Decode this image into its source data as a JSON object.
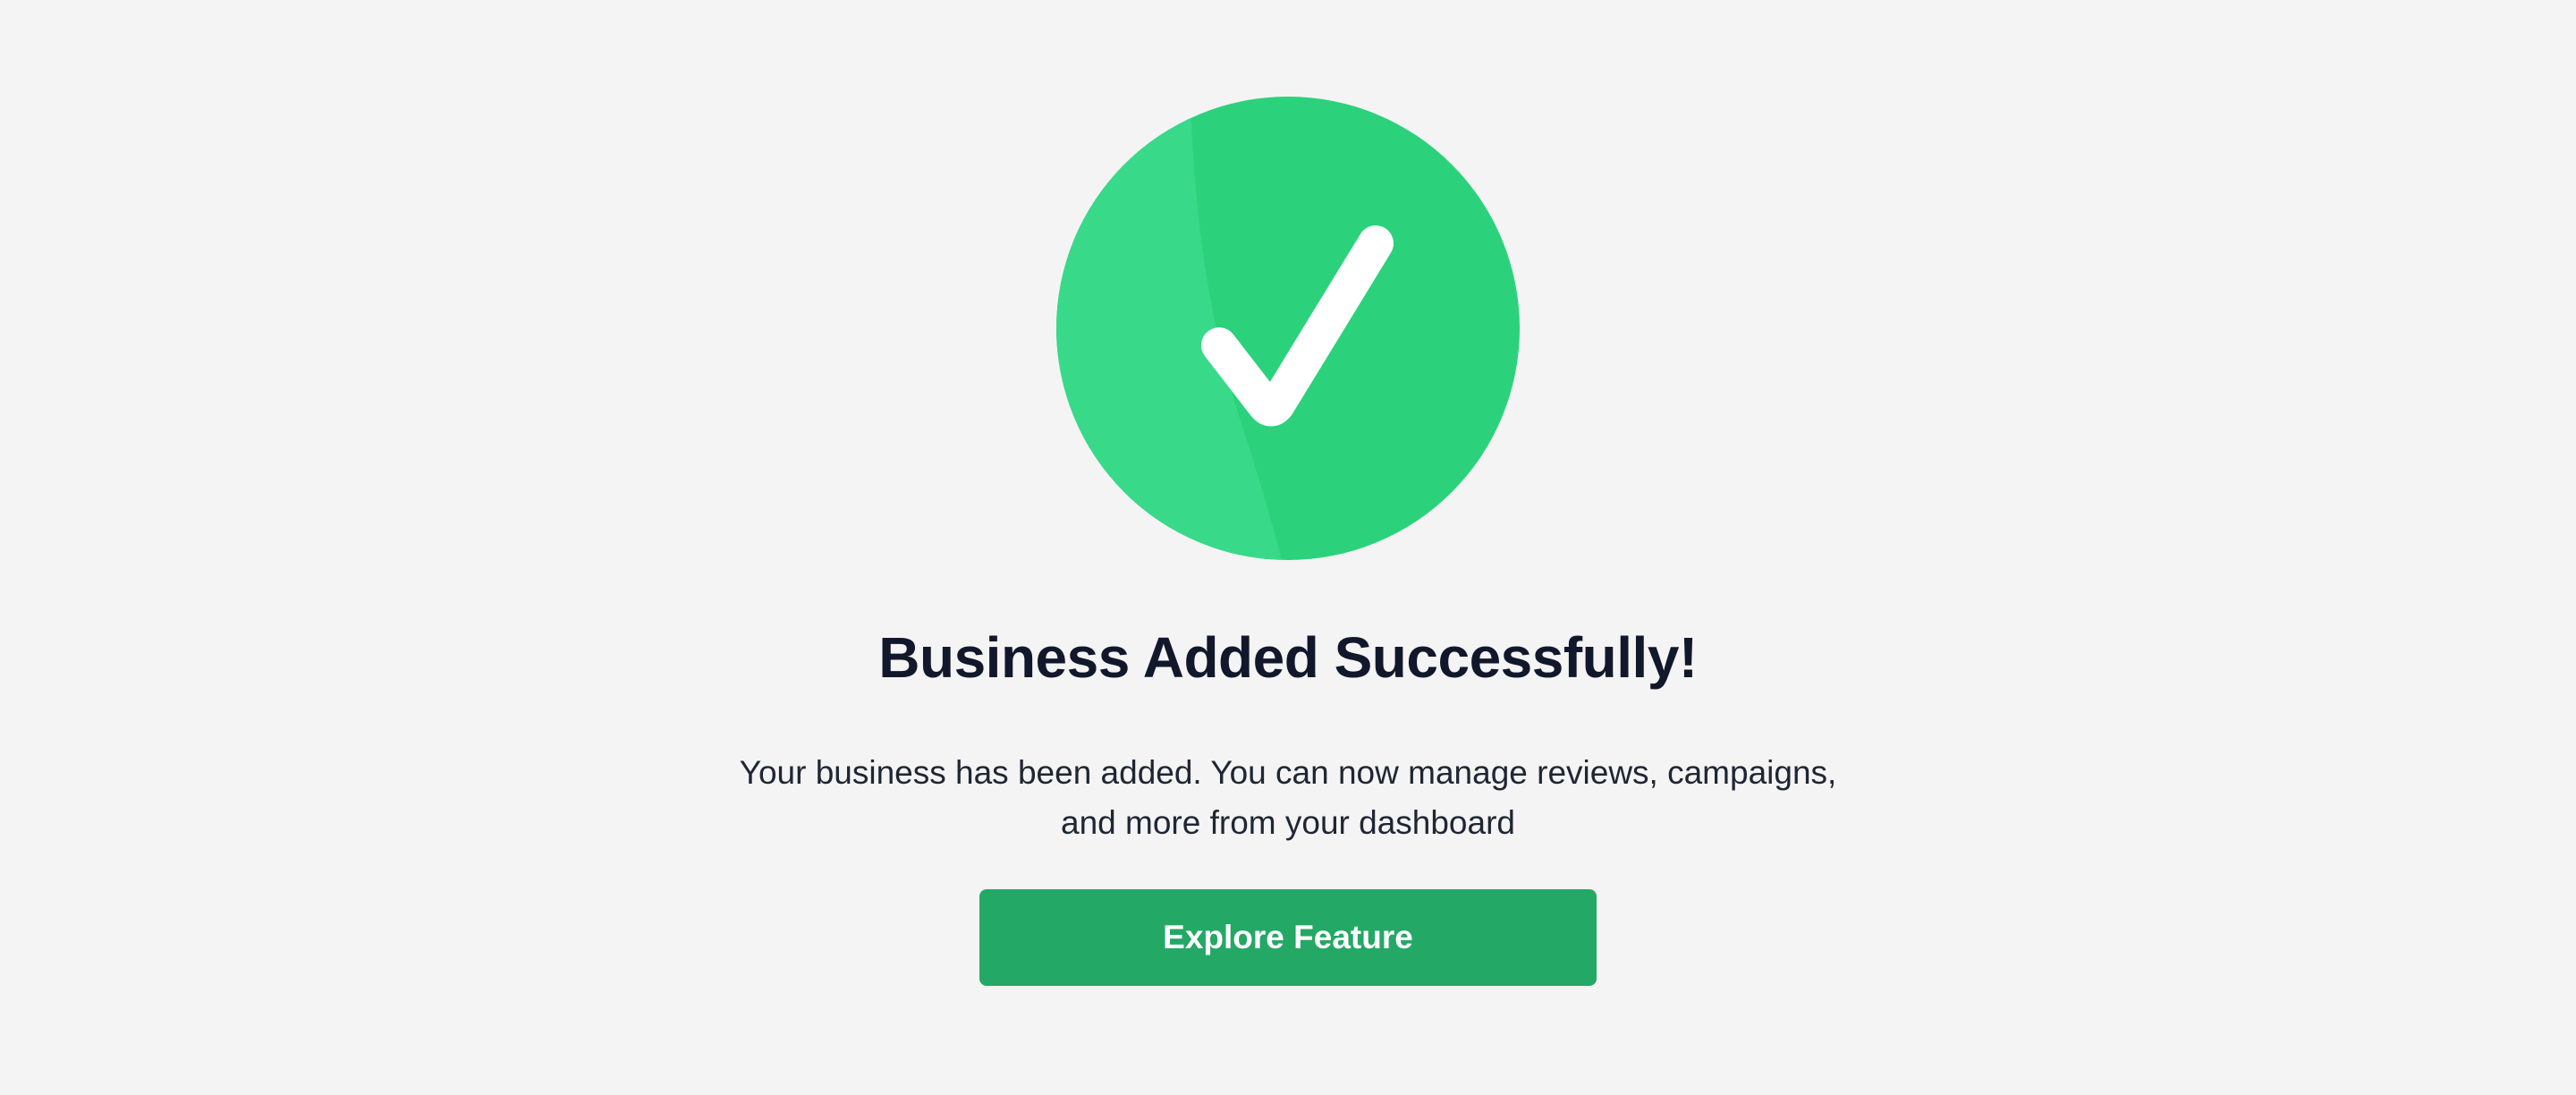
{
  "success": {
    "icon": "check-circle-icon",
    "title": "Business Added Successfully!",
    "message_line1": "Your business has been added. You can now manage reviews, campaigns,",
    "message_line2": "and more from your dashboard",
    "button_label": "Explore Feature"
  },
  "colors": {
    "background": "#f4f4f4",
    "circle_primary": "#2bd27b",
    "circle_highlight": "#39d98a",
    "button": "#24a866",
    "title_text": "#12182b"
  }
}
